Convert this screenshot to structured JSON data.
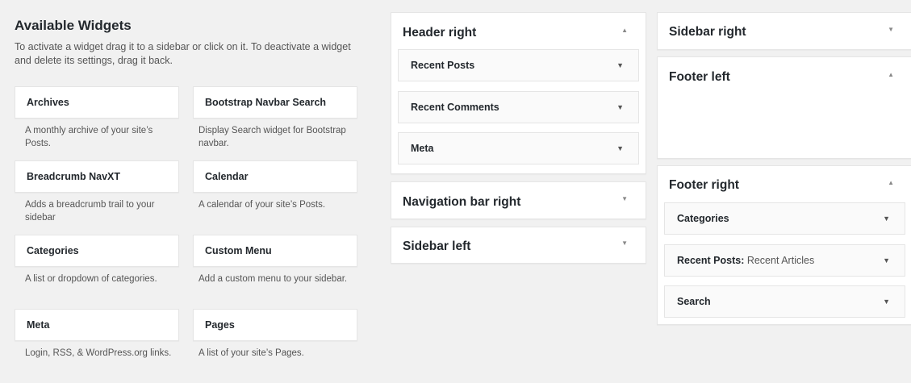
{
  "available": {
    "title": "Available Widgets",
    "description": "To activate a widget drag it to a sidebar or click on it. To deactivate a widget and delete its settings, drag it back.",
    "widgets": [
      {
        "name": "Archives",
        "desc": "A monthly archive of your site’s Posts."
      },
      {
        "name": "Bootstrap Navbar Search",
        "desc": "Display Search widget for Bootstrap navbar."
      },
      {
        "name": "Breadcrumb NavXT",
        "desc": "Adds a breadcrumb trail to your sidebar"
      },
      {
        "name": "Calendar",
        "desc": "A calendar of your site’s Posts."
      },
      {
        "name": "Categories",
        "desc": "A list or dropdown of categories."
      },
      {
        "name": "Custom Menu",
        "desc": "Add a custom menu to your sidebar."
      },
      {
        "name": "Meta",
        "desc": "Login, RSS, & WordPress.org links."
      },
      {
        "name": "Pages",
        "desc": "A list of your site’s Pages."
      }
    ]
  },
  "sidebars": {
    "header_right": {
      "title": "Header right",
      "widgets": [
        {
          "name": "Recent Posts"
        },
        {
          "name": "Recent Comments"
        },
        {
          "name": "Meta"
        }
      ]
    },
    "navigation_bar_right": {
      "title": "Navigation bar right"
    },
    "sidebar_left": {
      "title": "Sidebar left"
    },
    "sidebar_right": {
      "title": "Sidebar right"
    },
    "footer_left": {
      "title": "Footer left"
    },
    "footer_right": {
      "title": "Footer right",
      "widgets": [
        {
          "name": "Categories",
          "sub": ""
        },
        {
          "name": "Recent Posts:",
          "sub": " Recent Articles"
        },
        {
          "name": "Search",
          "sub": ""
        }
      ]
    }
  },
  "icons": {
    "expanded": "▲",
    "collapsed": "▼",
    "widget_toggle": "▼"
  }
}
